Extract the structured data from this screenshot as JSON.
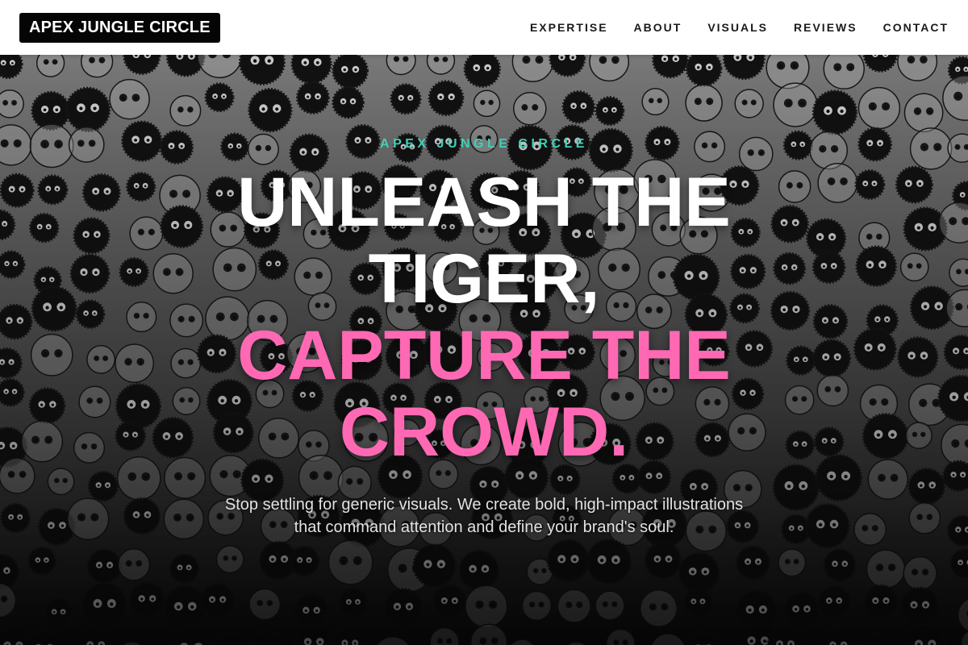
{
  "brand": {
    "logo_text": "APEX JUNGLE CIRCLE"
  },
  "nav": {
    "items": [
      {
        "label": "EXPERTISE"
      },
      {
        "label": "ABOUT"
      },
      {
        "label": "VISUALS"
      },
      {
        "label": "REVIEWS"
      },
      {
        "label": "CONTACT"
      }
    ]
  },
  "hero": {
    "eyebrow": "APEX JUNGLE CIRCLE",
    "headline_white": "UNLEASH THE TIGER,",
    "headline_pink": "CAPTURE THE CROWD.",
    "subtext": "Stop settling for generic visuals. We create bold, high-impact illustrations that command attention and define your brand's soul."
  },
  "colors": {
    "accent_teal": "#3fd0b9",
    "accent_pink": "#ff69b4",
    "logo_bg": "#050505",
    "nav_bg": "#ffffff"
  }
}
